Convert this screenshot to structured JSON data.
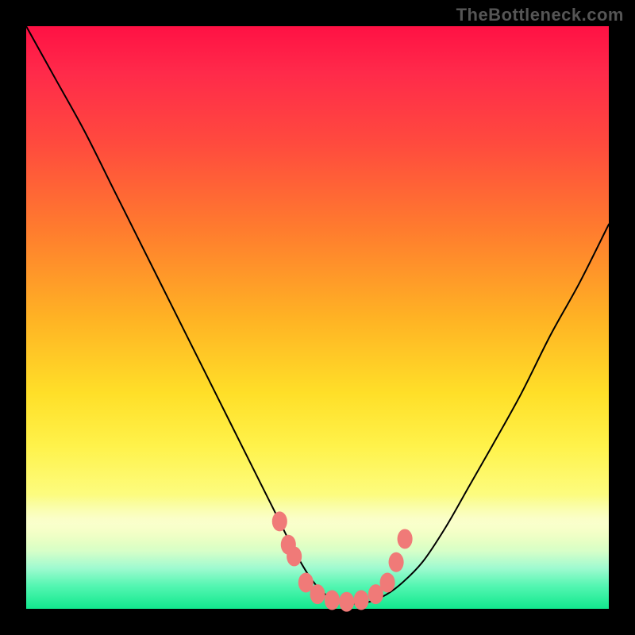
{
  "watermark": "TheBottleneck.com",
  "chart_data": {
    "type": "line",
    "title": "",
    "xlabel": "",
    "ylabel": "",
    "xlim": [
      0,
      100
    ],
    "ylim": [
      0,
      100
    ],
    "series": [
      {
        "name": "bottleneck-curve",
        "x": [
          0,
          5,
          10,
          15,
          20,
          25,
          30,
          35,
          40,
          43,
          46,
          49,
          52,
          55,
          58,
          61,
          64,
          68,
          72,
          76,
          80,
          85,
          90,
          95,
          100
        ],
        "values": [
          100,
          91,
          82,
          72,
          62,
          52,
          42,
          32,
          22,
          16,
          10,
          5,
          2,
          1,
          1,
          2,
          4,
          8,
          14,
          21,
          28,
          37,
          47,
          56,
          66
        ]
      }
    ],
    "markers": {
      "name": "threshold-dots",
      "points": [
        {
          "x": 43.5,
          "y": 15
        },
        {
          "x": 45.0,
          "y": 11
        },
        {
          "x": 46.0,
          "y": 9
        },
        {
          "x": 48.0,
          "y": 4.5
        },
        {
          "x": 50.0,
          "y": 2.5
        },
        {
          "x": 52.5,
          "y": 1.5
        },
        {
          "x": 55.0,
          "y": 1.2
        },
        {
          "x": 57.5,
          "y": 1.5
        },
        {
          "x": 60.0,
          "y": 2.5
        },
        {
          "x": 62.0,
          "y": 4.5
        },
        {
          "x": 63.5,
          "y": 8
        },
        {
          "x": 65.0,
          "y": 12
        }
      ]
    },
    "background_gradient": {
      "top": "#ff1144",
      "mid": "#ffdf28",
      "bottom": "#12e88e"
    }
  }
}
